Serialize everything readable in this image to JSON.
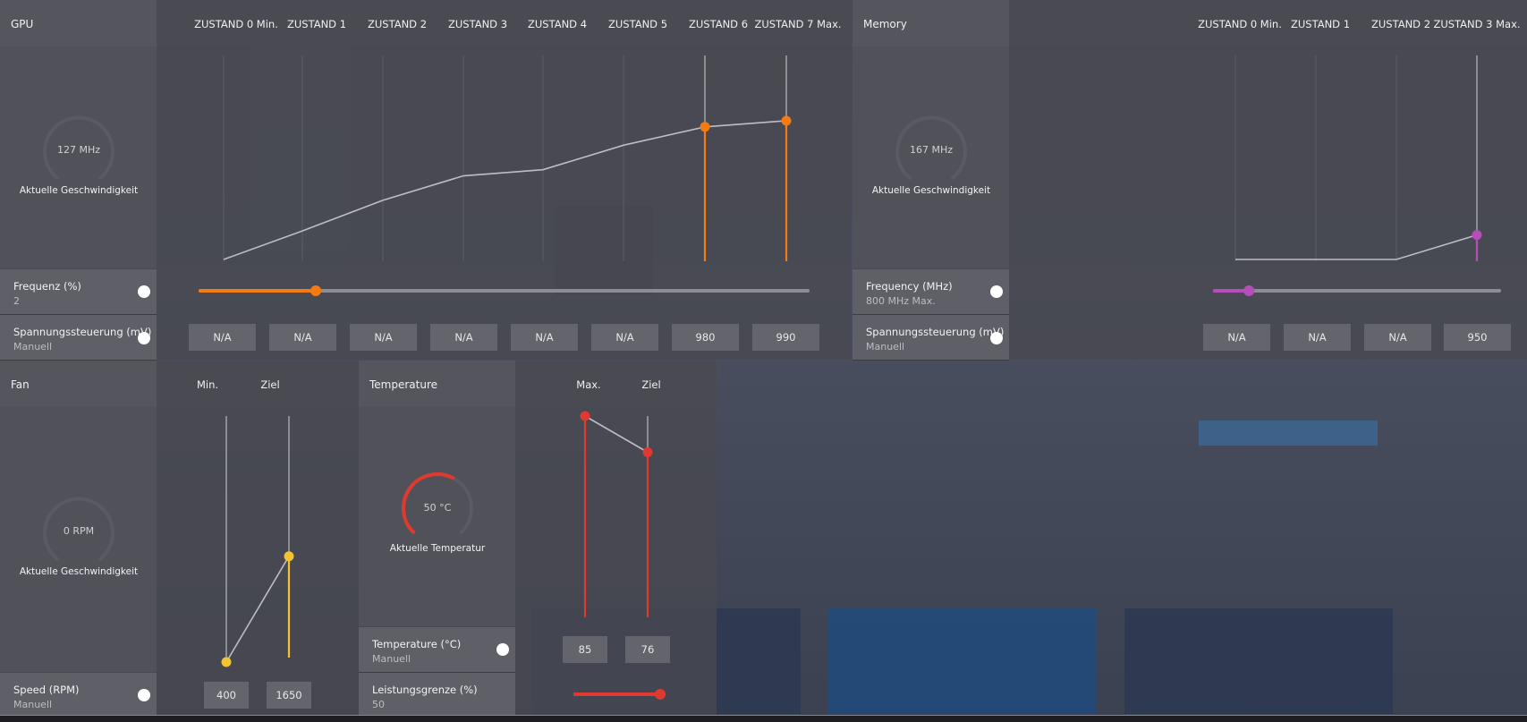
{
  "gpu": {
    "title": "GPU",
    "states": [
      "ZUSTAND 0 Min.",
      "ZUSTAND 1",
      "ZUSTAND 2",
      "ZUSTAND 3",
      "ZUSTAND 4",
      "ZUSTAND 5",
      "ZUSTAND 6",
      "ZUSTAND 7 Max."
    ],
    "gauge_value": "127 MHz",
    "gauge_caption": "Aktuelle Geschwindigkeit",
    "curve_levels": [
      0.0,
      0.14,
      0.29,
      0.41,
      0.44,
      0.56,
      0.65,
      0.68
    ],
    "active_states": [
      6,
      7
    ],
    "frequency_label": "Frequenz (%)",
    "frequency_value": "2",
    "frequency_slider": 0.19,
    "voltage_label": "Spannungssteuerung (mV)",
    "voltage_mode": "Manuell",
    "voltages": [
      "N/A",
      "N/A",
      "N/A",
      "N/A",
      "N/A",
      "N/A",
      "980",
      "990"
    ]
  },
  "memory": {
    "title": "Memory",
    "states": [
      "ZUSTAND 0 Min.",
      "ZUSTAND 1",
      "ZUSTAND 2",
      "ZUSTAND 3 Max."
    ],
    "gauge_value": "167 MHz",
    "gauge_caption": "Aktuelle Geschwindigkeit",
    "curve_levels": [
      0.0,
      0.0,
      0.0,
      0.12
    ],
    "active_states": [
      3
    ],
    "frequency_label": "Frequency (MHz)",
    "frequency_value": "800 MHz Max.",
    "frequency_slider": 0.12,
    "voltage_label": "Spannungssteuerung (mV)",
    "voltage_mode": "Manuell",
    "voltages": [
      "N/A",
      "N/A",
      "N/A",
      "950"
    ]
  },
  "fan": {
    "title": "Fan",
    "columns": [
      "Min.",
      "Ziel"
    ],
    "gauge_value": "0 RPM",
    "gauge_caption": "Aktuelle Geschwindigkeit",
    "levels": [
      0.0,
      0.43
    ],
    "speed_label": "Speed (RPM)",
    "speed_mode": "Manuell",
    "values": [
      "400",
      "1650"
    ]
  },
  "temperature": {
    "title": "Temperature",
    "columns": [
      "Max.",
      "Ziel"
    ],
    "gauge_value": "50 °C",
    "gauge_caption": "Aktuelle Temperatur",
    "gauge_fraction": 0.6,
    "levels": [
      1.0,
      0.82
    ],
    "temp_label": "Temperature (°C)",
    "temp_mode": "Manuell",
    "values": [
      "85",
      "76"
    ],
    "power_label": "Leistungsgrenze (%)",
    "power_value": "50",
    "power_slider": 1.0
  },
  "colors": {
    "gpu_accent": "#f47a12",
    "memory_accent": "#b74dbb",
    "fan_accent": "#f4c430",
    "temp_accent": "#e03a30",
    "curve": "#bdbdc3"
  }
}
